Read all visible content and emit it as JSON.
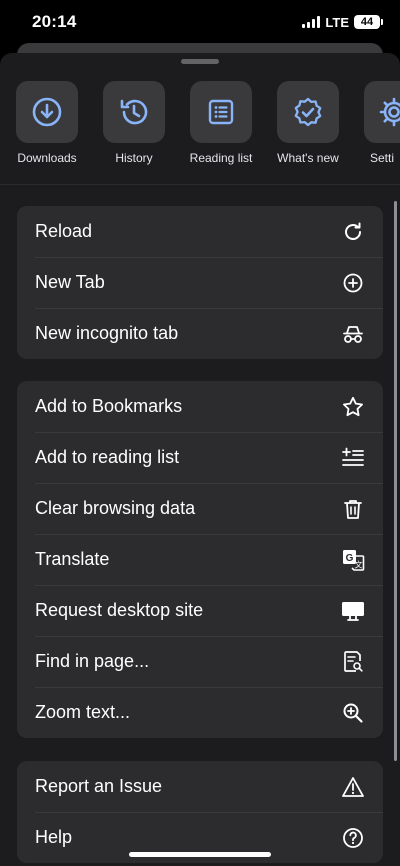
{
  "status_bar": {
    "time": "20:14",
    "network": "LTE",
    "battery": "44"
  },
  "quick_actions": [
    {
      "label": "Downloads",
      "icon": "download-icon"
    },
    {
      "label": "History",
      "icon": "history-icon"
    },
    {
      "label": "Reading list",
      "icon": "reading-list-icon"
    },
    {
      "label": "What's new",
      "icon": "whats-new-icon"
    },
    {
      "label": "Setti",
      "icon": "settings-icon"
    }
  ],
  "menu_group_1": [
    {
      "label": "Reload",
      "icon": "reload-icon"
    },
    {
      "label": "New Tab",
      "icon": "plus-circle-icon"
    },
    {
      "label": "New incognito tab",
      "icon": "incognito-icon"
    }
  ],
  "menu_group_2": [
    {
      "label": "Add to Bookmarks",
      "icon": "star-icon"
    },
    {
      "label": "Add to reading list",
      "icon": "add-reading-list-icon"
    },
    {
      "label": "Clear browsing data",
      "icon": "trash-icon"
    },
    {
      "label": "Translate",
      "icon": "translate-icon"
    },
    {
      "label": "Request desktop site",
      "icon": "desktop-icon"
    },
    {
      "label": "Find in page...",
      "icon": "find-in-page-icon"
    },
    {
      "label": "Zoom text...",
      "icon": "zoom-in-icon"
    }
  ],
  "menu_group_3": [
    {
      "label": "Report an Issue",
      "icon": "warning-icon"
    },
    {
      "label": "Help",
      "icon": "help-icon"
    }
  ],
  "colors": {
    "accent": "#8ab4f8",
    "sheet_background": "#1c1c1e",
    "group_background": "#2c2c2e",
    "tile_background": "#3a3a3c"
  }
}
